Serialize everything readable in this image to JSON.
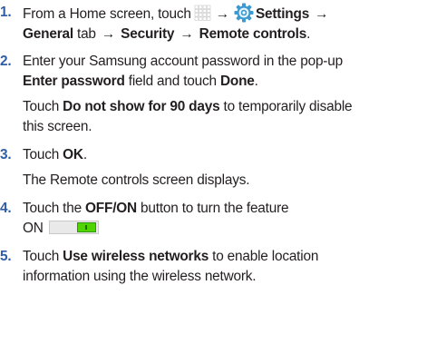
{
  "steps": [
    {
      "number": "1.",
      "line1": {
        "t1": "From a Home screen, touch",
        "arrow1": "→",
        "settings": "Settings",
        "arrow2": "→"
      },
      "line2": {
        "general": "General",
        "t1": " tab ",
        "arrow1": "→",
        "security": " Security ",
        "arrow2": "→",
        "remote": " Remote controls",
        "end": "."
      },
      "icons": [
        "apps-grid-icon",
        "settings-gear-icon"
      ]
    },
    {
      "number": "2.",
      "line1": "Enter your Samsung account password in the pop-up",
      "line2": {
        "field": "Enter password",
        "t1": " field and touch ",
        "done": "Done",
        "end": "."
      },
      "note": {
        "t1": "Touch ",
        "bold": "Do not show for 90 days",
        "t2": " to temporarily disable",
        "t3": "this screen."
      }
    },
    {
      "number": "3.",
      "line1": {
        "t1": "Touch ",
        "ok": "OK",
        "end": "."
      },
      "note": "The Remote controls screen displays."
    },
    {
      "number": "4.",
      "line1": {
        "t1": "Touch the ",
        "offon": "OFF/ON",
        "t2": " button to turn the feature"
      },
      "line2": "ON",
      "toggle_state": "on",
      "toggle_color": "#4fd400"
    },
    {
      "number": "5.",
      "line1": {
        "t1": "Touch ",
        "bold": "Use wireless networks",
        "t2": " to enable location"
      },
      "line2": "information using the wireless network."
    }
  ],
  "colors": {
    "step_number": "#2e5ea8",
    "text": "#231f20",
    "toggle_on": "#4fd400"
  }
}
